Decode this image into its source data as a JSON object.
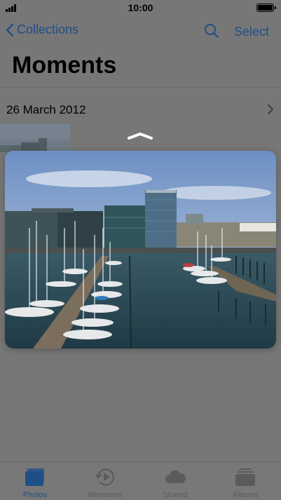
{
  "status_bar": {
    "time": "10:00"
  },
  "nav": {
    "back_label": "Collections",
    "select_label": "Select"
  },
  "page": {
    "title": "Moments"
  },
  "section": {
    "date": "26 March 2012"
  },
  "preview": {
    "description": ""
  },
  "tabbar": {
    "tabs": [
      {
        "label": "Photos",
        "icon": "photos-icon",
        "active": true
      },
      {
        "label": "Memories",
        "icon": "memories-icon",
        "active": false
      },
      {
        "label": "Shared",
        "icon": "cloud-icon",
        "active": false
      },
      {
        "label": "Albums",
        "icon": "albums-icon",
        "active": false
      }
    ]
  },
  "colors": {
    "accent": "#1f4f87",
    "dim_background": "#777777",
    "tab_inactive": "#5b5b5b"
  }
}
